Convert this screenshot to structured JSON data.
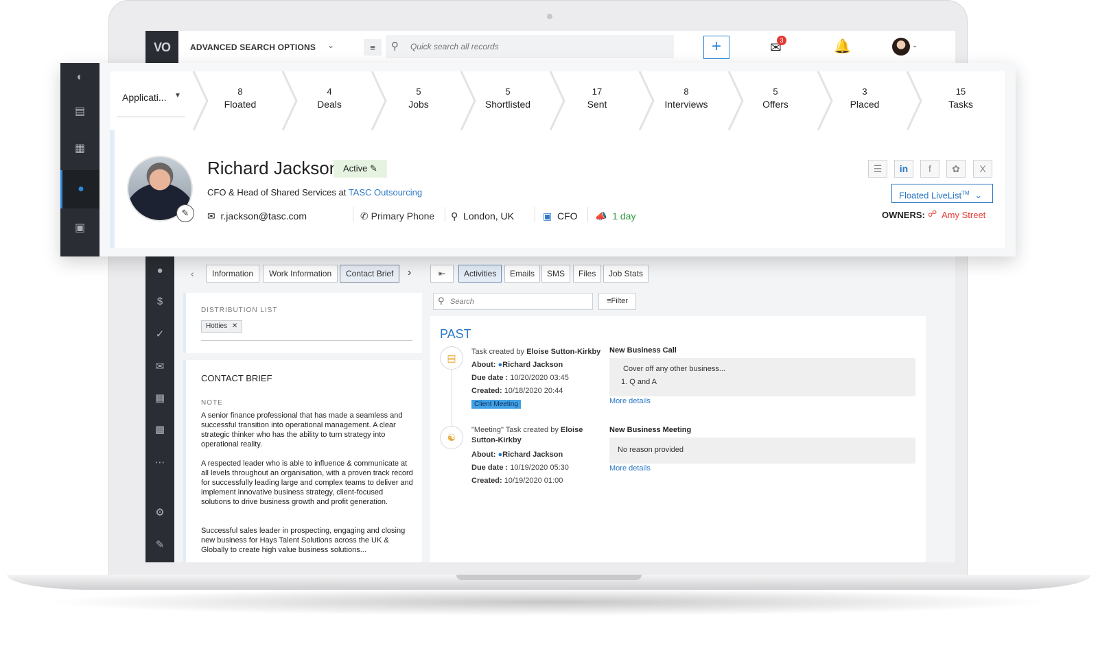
{
  "topbar": {
    "logo": "VO",
    "advanced_search": "ADVANCED SEARCH OPTIONS",
    "search_placeholder": "Quick search all records",
    "notification_count": "3"
  },
  "pipeline": {
    "dropdown": "Applicati...",
    "stages": [
      {
        "count": "8",
        "label": "Floated"
      },
      {
        "count": "4",
        "label": "Deals"
      },
      {
        "count": "5",
        "label": "Jobs"
      },
      {
        "count": "5",
        "label": "Shortlisted"
      },
      {
        "count": "17",
        "label": "Sent"
      },
      {
        "count": "8",
        "label": "Interviews"
      },
      {
        "count": "5",
        "label": "Offers"
      },
      {
        "count": "3",
        "label": "Placed"
      },
      {
        "count": "15",
        "label": "Tasks"
      }
    ]
  },
  "profile": {
    "name": "Richard Jackson",
    "status": "Active",
    "title_prefix": "CFO & Head of Shared Services at",
    "company": "TASC Outsourcing",
    "email": "r.jackson@tasc.com",
    "phone": "Primary Phone",
    "location": "London, UK",
    "role": "CFO",
    "last_contact": "1 day",
    "livelist": "Floated LiveList",
    "livelist_sup": "TM",
    "owners_label": "OWNERS:",
    "owner": "Amy Street"
  },
  "left_tabs": [
    "Information",
    "Work Information",
    "Contact Brief"
  ],
  "distribution": {
    "label": "DISTRIBUTION LIST",
    "chip": "Hotties"
  },
  "brief": {
    "heading": "CONTACT BRIEF",
    "note_label": "NOTE",
    "p1": "A senior finance professional that has made a seamless and successful transition into operational management. A clear strategic thinker who has the ability to turn strategy into operational reality.",
    "p2": "A respected leader who is able to influence & communicate at all levels throughout an organisation, with a proven track record for successfully leading large and complex teams to deliver and implement innovative business strategy, client-focused solutions to drive business growth and profit generation.",
    "p3": "Successful sales leader in prospecting, engaging and closing new business for Hays Talent Solutions across the UK & Globally to create high value business solutions..."
  },
  "activity_tabs": [
    "Activities",
    "Emails",
    "SMS",
    "Files",
    "Job Stats"
  ],
  "activity_search_placeholder": "Search",
  "filter_label": "Filter",
  "past_label": "PAST",
  "activities": [
    {
      "created_by_prefix": "Task created by",
      "created_by": "Eloise Sutton-Kirkby",
      "about_label": "About:",
      "about": "Richard Jackson",
      "due_label": "Due date :",
      "due": "10/20/2020 03:45",
      "created_label": "Created:",
      "created": "10/18/2020 20:44",
      "tag": "Client Meeting",
      "title": "New Business Call",
      "body_line1": "Cover off any other business...",
      "body_line2": "1. Q and A",
      "more": "More details"
    },
    {
      "created_by_prefix": "\"Meeting\" Task created by",
      "created_by": "Eloise",
      "created_by_2": "Sutton-Kirkby",
      "about_label": "About:",
      "about": "Richard Jackson",
      "due_label": "Due date :",
      "due": "10/19/2020 05:30",
      "created_label": "Created:",
      "created": "10/19/2020 01:00",
      "title": "New Business Meeting",
      "body_line1": "No reason provided",
      "more": "More details"
    }
  ],
  "colors": {
    "accent": "#2b78c5",
    "sidebar": "#2a2d33",
    "owner": "#e53935",
    "active_status": "#e6f3e1"
  }
}
